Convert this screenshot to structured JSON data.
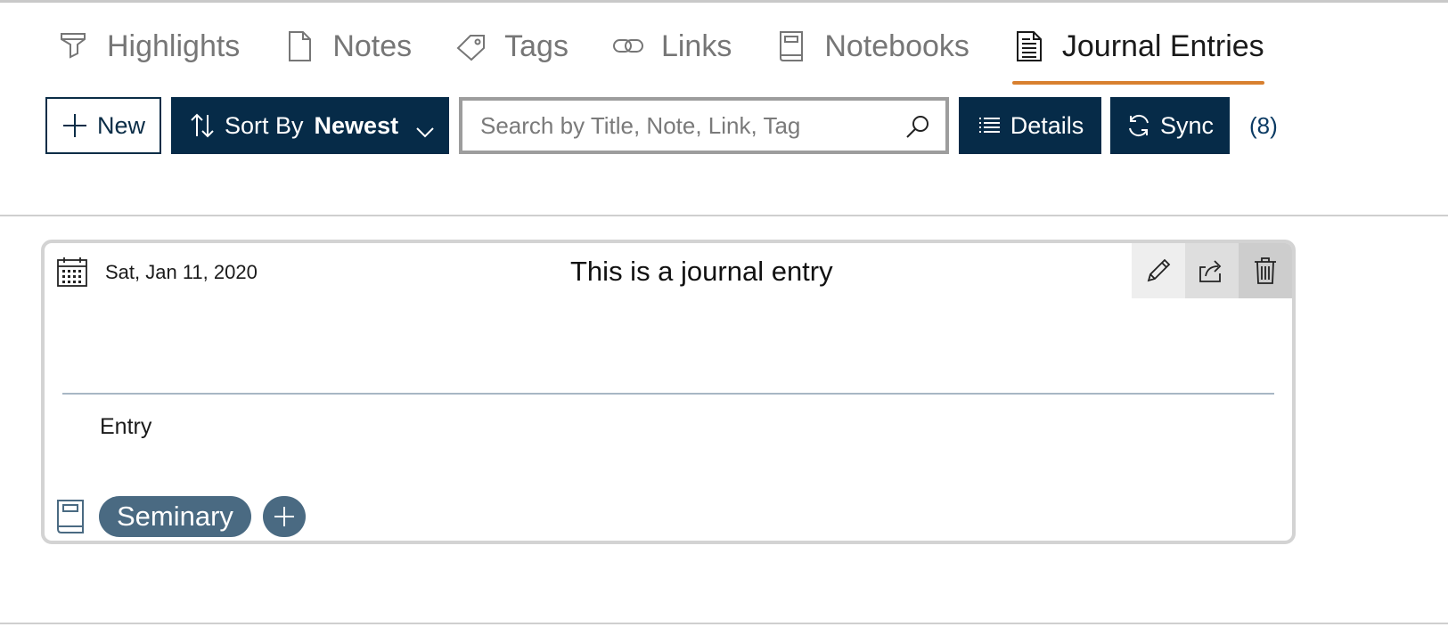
{
  "tabs": [
    {
      "label": "Highlights",
      "icon": "highlighter-icon",
      "active": false
    },
    {
      "label": "Notes",
      "icon": "note-page-icon",
      "active": false
    },
    {
      "label": "Tags",
      "icon": "tag-icon",
      "active": false
    },
    {
      "label": "Links",
      "icon": "link-icon",
      "active": false
    },
    {
      "label": "Notebooks",
      "icon": "notebook-icon",
      "active": false
    },
    {
      "label": "Journal Entries",
      "icon": "journal-document-icon",
      "active": true
    }
  ],
  "toolbar": {
    "new_label": "New",
    "sort_label": "Sort By",
    "sort_value": "Newest",
    "search_placeholder": "Search by Title, Note, Link, Tag",
    "search_value": "",
    "details_label": "Details",
    "sync_label": "Sync",
    "count": "(8)"
  },
  "entry": {
    "date": "Sat, Jan 11, 2020",
    "title": "This is a journal entry",
    "body": "Entry",
    "notebook_tag": "Seminary",
    "actions": [
      "edit-icon",
      "share-icon",
      "delete-icon"
    ]
  },
  "colors": {
    "accent_underline": "#d8802f",
    "button_dark": "#062b48",
    "chip": "#4a6a82",
    "count_text": "#0b3a63"
  }
}
